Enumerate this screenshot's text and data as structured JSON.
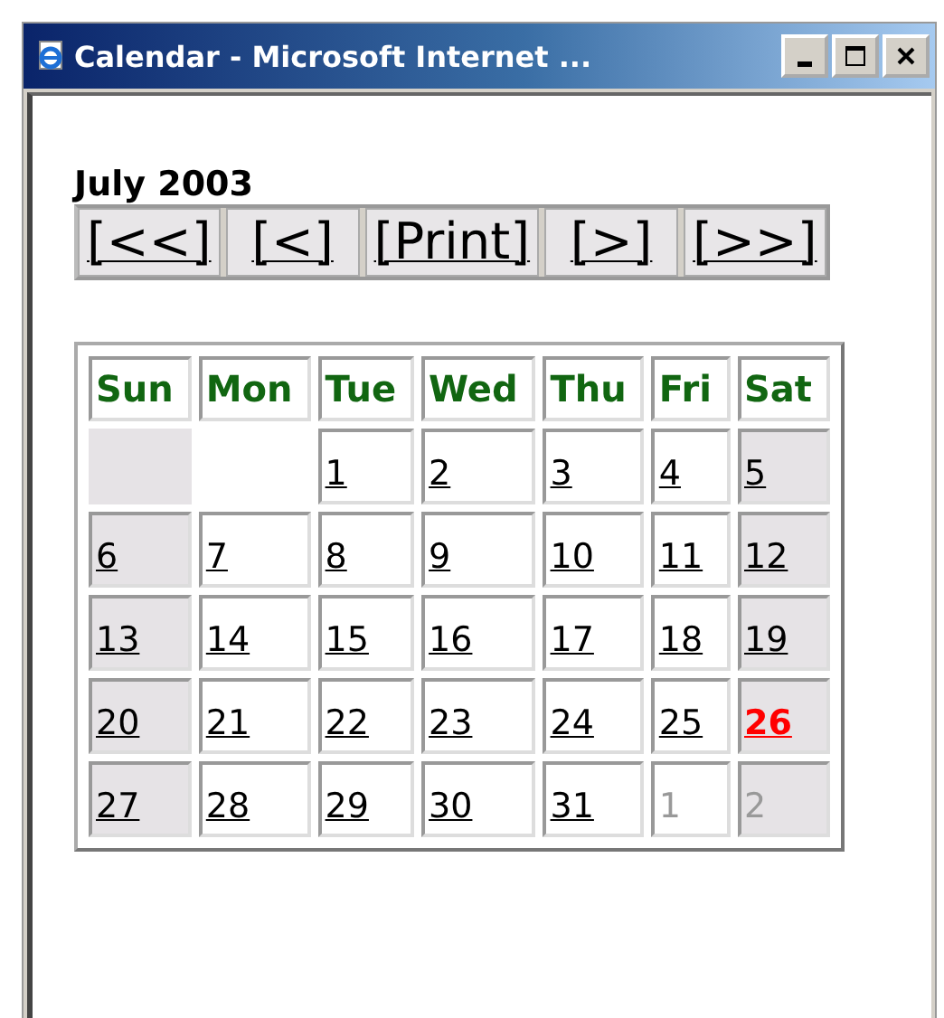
{
  "window": {
    "title": "Calendar - Microsoft Internet ..."
  },
  "month_title": "July 2003",
  "nav_buttons": [
    "[<<]",
    "[<]",
    "[Print]",
    "[>]",
    "[>>]"
  ],
  "weekdays": [
    "Sun",
    "Mon",
    "Tue",
    "Wed",
    "Thu",
    "Fri",
    "Sat"
  ],
  "weeks": [
    [
      {
        "kind": "blank",
        "weekend": true
      },
      {
        "kind": "blank",
        "weekend": false
      },
      {
        "kind": "day",
        "text": "1",
        "weekend": false,
        "selected": false
      },
      {
        "kind": "day",
        "text": "2",
        "weekend": false,
        "selected": false
      },
      {
        "kind": "day",
        "text": "3",
        "weekend": false,
        "selected": false
      },
      {
        "kind": "day",
        "text": "4",
        "weekend": false,
        "selected": false
      },
      {
        "kind": "day",
        "text": "5",
        "weekend": true,
        "selected": false
      }
    ],
    [
      {
        "kind": "day",
        "text": "6",
        "weekend": true,
        "selected": false
      },
      {
        "kind": "day",
        "text": "7",
        "weekend": false,
        "selected": false
      },
      {
        "kind": "day",
        "text": "8",
        "weekend": false,
        "selected": false
      },
      {
        "kind": "day",
        "text": "9",
        "weekend": false,
        "selected": false
      },
      {
        "kind": "day",
        "text": "10",
        "weekend": false,
        "selected": false
      },
      {
        "kind": "day",
        "text": "11",
        "weekend": false,
        "selected": false
      },
      {
        "kind": "day",
        "text": "12",
        "weekend": true,
        "selected": false
      }
    ],
    [
      {
        "kind": "day",
        "text": "13",
        "weekend": true,
        "selected": false
      },
      {
        "kind": "day",
        "text": "14",
        "weekend": false,
        "selected": false
      },
      {
        "kind": "day",
        "text": "15",
        "weekend": false,
        "selected": false
      },
      {
        "kind": "day",
        "text": "16",
        "weekend": false,
        "selected": false
      },
      {
        "kind": "day",
        "text": "17",
        "weekend": false,
        "selected": false
      },
      {
        "kind": "day",
        "text": "18",
        "weekend": false,
        "selected": false
      },
      {
        "kind": "day",
        "text": "19",
        "weekend": true,
        "selected": false
      }
    ],
    [
      {
        "kind": "day",
        "text": "20",
        "weekend": true,
        "selected": false
      },
      {
        "kind": "day",
        "text": "21",
        "weekend": false,
        "selected": false
      },
      {
        "kind": "day",
        "text": "22",
        "weekend": false,
        "selected": false
      },
      {
        "kind": "day",
        "text": "23",
        "weekend": false,
        "selected": false
      },
      {
        "kind": "day",
        "text": "24",
        "weekend": false,
        "selected": false
      },
      {
        "kind": "day",
        "text": "25",
        "weekend": false,
        "selected": false
      },
      {
        "kind": "day",
        "text": "26",
        "weekend": true,
        "selected": true
      }
    ],
    [
      {
        "kind": "day",
        "text": "27",
        "weekend": true,
        "selected": false
      },
      {
        "kind": "day",
        "text": "28",
        "weekend": false,
        "selected": false
      },
      {
        "kind": "day",
        "text": "29",
        "weekend": false,
        "selected": false
      },
      {
        "kind": "day",
        "text": "30",
        "weekend": false,
        "selected": false
      },
      {
        "kind": "day",
        "text": "31",
        "weekend": false,
        "selected": false
      },
      {
        "kind": "other",
        "text": "1",
        "weekend": false,
        "selected": false
      },
      {
        "kind": "other",
        "text": "2",
        "weekend": true,
        "selected": false
      }
    ]
  ]
}
